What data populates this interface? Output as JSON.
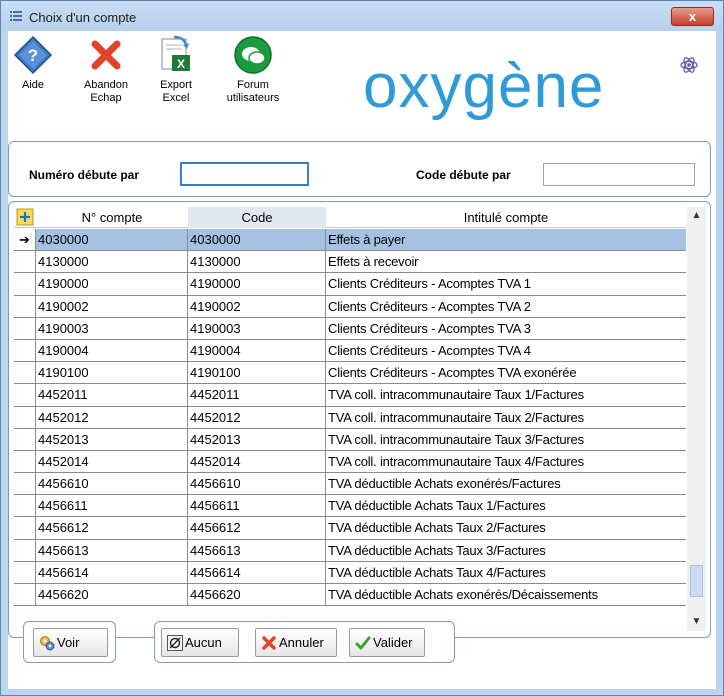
{
  "window": {
    "title": "Choix d'un compte",
    "close_label": "x"
  },
  "toolbar": {
    "aide": "Aide",
    "abandon_line1": "Abandon",
    "abandon_line2": "Echap",
    "export_line1": "Export",
    "export_line2": "Excel",
    "forum_line1": "Forum",
    "forum_line2": "utilisateurs"
  },
  "logo": {
    "text": "oxygène"
  },
  "filters": {
    "numero_label": "Numéro débute par",
    "numero_value": "",
    "code_label": "Code débute par",
    "code_value": ""
  },
  "grid": {
    "columns": [
      "N° compte",
      "Code",
      "Intitulé compte"
    ],
    "rows": [
      {
        "num": "4030000",
        "code": "4030000",
        "intitule": "Effets à payer",
        "selected": true
      },
      {
        "num": "4130000",
        "code": "4130000",
        "intitule": "Effets à recevoir"
      },
      {
        "num": "4190000",
        "code": "4190000",
        "intitule": "Clients Créditeurs - Acomptes TVA 1"
      },
      {
        "num": "4190002",
        "code": "4190002",
        "intitule": "Clients Créditeurs - Acomptes TVA 2"
      },
      {
        "num": "4190003",
        "code": "4190003",
        "intitule": "Clients Créditeurs - Acomptes TVA 3"
      },
      {
        "num": "4190004",
        "code": "4190004",
        "intitule": "Clients Créditeurs - Acomptes TVA 4"
      },
      {
        "num": "4190100",
        "code": "4190100",
        "intitule": "Clients Créditeurs - Acomptes TVA exonérée"
      },
      {
        "num": "4452011",
        "code": "4452011",
        "intitule": "TVA coll. intracommunautaire Taux 1/Factures"
      },
      {
        "num": "4452012",
        "code": "4452012",
        "intitule": "TVA coll. intracommunautaire Taux 2/Factures"
      },
      {
        "num": "4452013",
        "code": "4452013",
        "intitule": "TVA coll. intracommunautaire Taux 3/Factures"
      },
      {
        "num": "4452014",
        "code": "4452014",
        "intitule": "TVA coll. intracommunautaire Taux 4/Factures"
      },
      {
        "num": "4456610",
        "code": "4456610",
        "intitule": "TVA déductible Achats exonérés/Factures"
      },
      {
        "num": "4456611",
        "code": "4456611",
        "intitule": "TVA déductible Achats Taux 1/Factures"
      },
      {
        "num": "4456612",
        "code": "4456612",
        "intitule": "TVA déductible Achats Taux 2/Factures"
      },
      {
        "num": "4456613",
        "code": "4456613",
        "intitule": "TVA déductible Achats Taux 3/Factures"
      },
      {
        "num": "4456614",
        "code": "4456614",
        "intitule": "TVA déductible Achats Taux 4/Factures"
      },
      {
        "num": "4456620",
        "code": "4456620",
        "intitule": "TVA déductible Achats exonérés/Décaissements"
      }
    ]
  },
  "buttons": {
    "voir": "Voir",
    "aucun": "Aucun",
    "annuler": "Annuler",
    "valider": "Valider"
  },
  "icons": {
    "aide": "help-diamond-icon",
    "abandon": "red-x-icon",
    "export": "excel-export-icon",
    "forum": "forum-chat-icon"
  },
  "colors": {
    "window_frame": "#bcd5ef",
    "selected_row": "#a6c2e3",
    "logo_blue": "#2f9ad8",
    "close_red": "#c8402c"
  }
}
